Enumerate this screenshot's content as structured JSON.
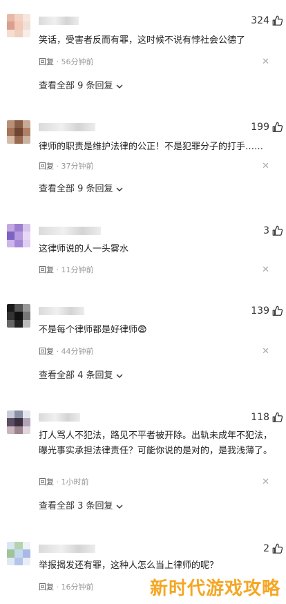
{
  "comments": [
    {
      "likes": "324",
      "text": "笑话，受害者反而有罪，这时候不说有悖社会公德了",
      "reply": "回复",
      "time": "56分钟前",
      "more": "查看全部 9 条回复"
    },
    {
      "likes": "199",
      "text": "律师的职责是维护法律的公正！不是犯罪分子的打手……",
      "reply": "回复",
      "time": "37分钟前",
      "more": "查看全部 9 条回复"
    },
    {
      "likes": "3",
      "text": "这律师说的人一头雾水",
      "reply": "回复",
      "time": "11分钟前",
      "more": ""
    },
    {
      "likes": "139",
      "text": "不是每个律师都是好律师😨",
      "reply": "回复",
      "time": "44分钟前",
      "more": "查看全部 4 条回复"
    },
    {
      "likes": "118",
      "text": "打人骂人不犯法，路见不平者被开除。出轨未成年不犯法，曝光事实承担法律责任？可能你说的是对的，是我浅薄了。",
      "reply": "回复",
      "time": "1小时前",
      "more": "查看全部 3 条回复"
    },
    {
      "likes": "2",
      "text": "举报揭发还有罪，这种人怎么当上律师的呢？",
      "reply": "回复",
      "time": "16分钟前",
      "more": ""
    }
  ],
  "separator": " · ",
  "dismiss": "✕",
  "watermark": "新时代游戏攻略",
  "colors": {
    "watermark": "#f5a623",
    "meta": "#999999"
  }
}
